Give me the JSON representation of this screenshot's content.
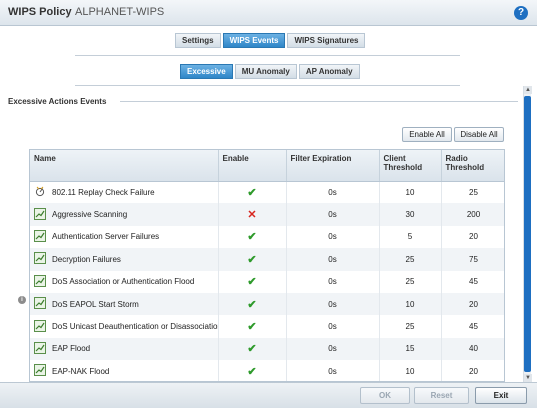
{
  "header": {
    "title": "WIPS Policy",
    "policy_name": "ALPHANET-WIPS",
    "help_icon": "help-icon"
  },
  "main_tabs": [
    {
      "label": "Settings",
      "active": false
    },
    {
      "label": "WIPS Events",
      "active": true
    },
    {
      "label": "WIPS Signatures",
      "active": false
    }
  ],
  "sub_tabs": [
    {
      "label": "Excessive",
      "active": true
    },
    {
      "label": "MU Anomaly",
      "active": false
    },
    {
      "label": "AP Anomaly",
      "active": false
    }
  ],
  "section": {
    "title": "Excessive Actions Events",
    "enable_all": "Enable All",
    "disable_all": "Disable All"
  },
  "table": {
    "columns": [
      "Name",
      "Enable",
      "Filter Expiration",
      "Client Threshold",
      "Radio Threshold"
    ],
    "rows": [
      {
        "icon": "replay-check-icon",
        "name": "802.11 Replay Check Failure",
        "enabled": true,
        "expiration": "0s",
        "client": "10",
        "radio": "25"
      },
      {
        "icon": "chart-icon",
        "name": "Aggressive Scanning",
        "enabled": false,
        "expiration": "0s",
        "client": "30",
        "radio": "200"
      },
      {
        "icon": "chart-icon",
        "name": "Authentication Server Failures",
        "enabled": true,
        "expiration": "0s",
        "client": "5",
        "radio": "20"
      },
      {
        "icon": "chart-icon",
        "name": "Decryption Failures",
        "enabled": true,
        "expiration": "0s",
        "client": "25",
        "radio": "75"
      },
      {
        "icon": "chart-icon",
        "name": "DoS Association or Authentication Flood",
        "enabled": true,
        "expiration": "0s",
        "client": "25",
        "radio": "45"
      },
      {
        "icon": "chart-icon",
        "name": "DoS EAPOL Start Storm",
        "enabled": true,
        "expiration": "0s",
        "client": "10",
        "radio": "20"
      },
      {
        "icon": "chart-icon",
        "name": "DoS Unicast Deauthentication or Disassociation",
        "enabled": true,
        "expiration": "0s",
        "client": "25",
        "radio": "45"
      },
      {
        "icon": "chart-icon",
        "name": "EAP Flood",
        "enabled": true,
        "expiration": "0s",
        "client": "15",
        "radio": "40"
      },
      {
        "icon": "chart-icon",
        "name": "EAP-NAK Flood",
        "enabled": true,
        "expiration": "0s",
        "client": "10",
        "radio": "20"
      }
    ]
  },
  "footer": {
    "ok": "OK",
    "reset": "Reset",
    "exit": "Exit"
  },
  "colors": {
    "accent": "#2f86c8",
    "enabled": "#2e9a2b",
    "disabled": "#d8261f"
  }
}
